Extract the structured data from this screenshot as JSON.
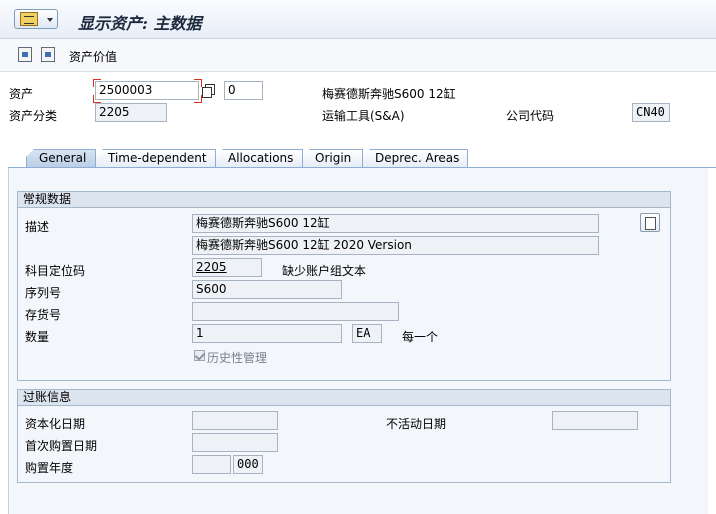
{
  "window": {
    "title": "显示资产: 主数据"
  },
  "toolbar": {
    "asset_values_label": "资产价值"
  },
  "header": {
    "asset_label": "资产",
    "asset_number": "2500003",
    "sub_number": "0",
    "asset_description": "梅赛德斯奔驰S600 12缸",
    "asset_class_label": "资产分类",
    "asset_class": "2205",
    "asset_class_desc": "运输工具(S&A)",
    "company_code_label": "公司代码",
    "company_code": "CN40"
  },
  "tabs": [
    {
      "label": "General",
      "active": true
    },
    {
      "label": "Time-dependent",
      "active": false
    },
    {
      "label": "Allocations",
      "active": false
    },
    {
      "label": "Origin",
      "active": false
    },
    {
      "label": "Deprec. Areas",
      "active": false
    }
  ],
  "general_data": {
    "title": "常规数据",
    "description_label": "描述",
    "description_1": "梅赛德斯奔驰S600 12缸",
    "description_2": "梅赛德斯奔驰S600 12缸 2020 Version",
    "account_determination_label": "科目定位码",
    "account_determination": "2205",
    "account_determination_note": "缺少账户组文本",
    "serial_number_label": "序列号",
    "serial_number": "S600",
    "inventory_number_label": "存货号",
    "inventory_number": "",
    "quantity_label": "数量",
    "quantity": "1",
    "unit": "EA",
    "unit_text": "每一个",
    "history_label": "历史性管理",
    "history_checked": true
  },
  "posting_info": {
    "title": "过账信息",
    "capitalization_date_label": "资本化日期",
    "capitalization_date": "",
    "first_acquisition_label": "首次购置日期",
    "first_acquisition": "",
    "acquisition_year_label": "购置年度",
    "acquisition_year": "",
    "acquisition_period": "000",
    "deactivation_date_label": "不活动日期",
    "deactivation_date": ""
  }
}
